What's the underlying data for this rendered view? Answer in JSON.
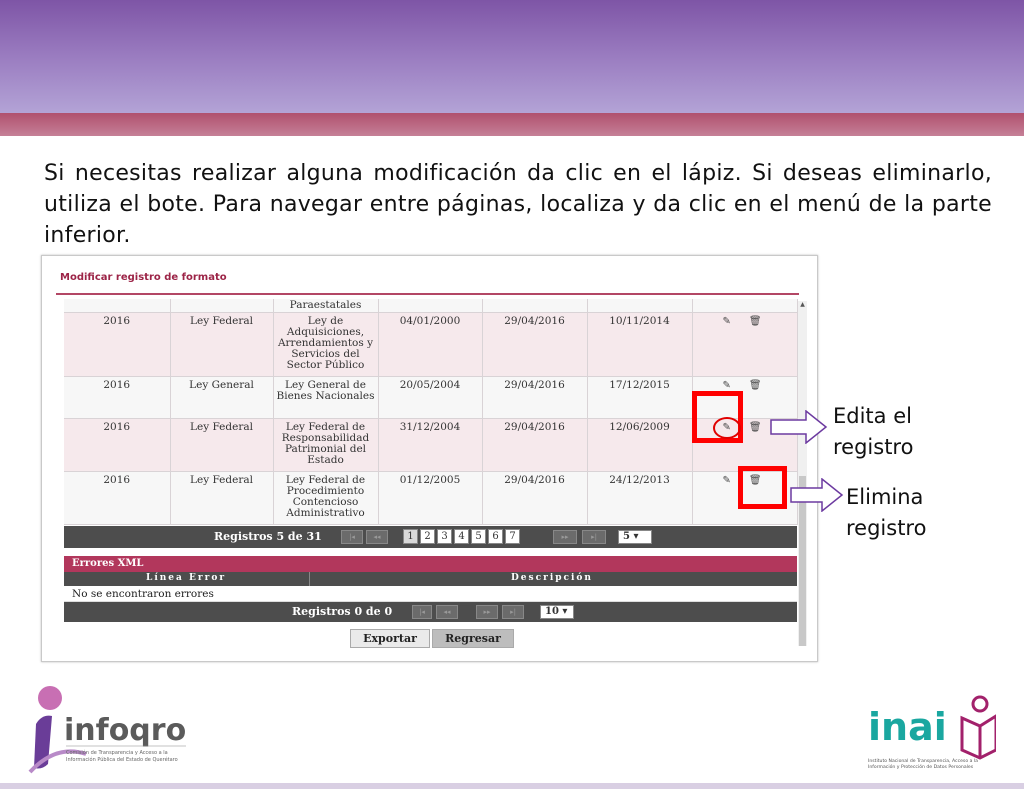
{
  "instruction": "Si necesitas realizar alguna modificación da clic en el lápiz. Si deseas eliminarlo, utiliza el bote. Para navegar entre páginas, localiza y da clic en el menú de la parte inferior.",
  "panel": {
    "title": "Modificar registro de formato",
    "header_cell": "Paraestatales",
    "rows": [
      {
        "year": "2016",
        "type": "Ley Federal",
        "name": "Ley de Adquisiciones, Arrendamientos y Servicios del Sector Público",
        "d1": "04/01/2000",
        "d2": "29/04/2016",
        "d3": "10/11/2014"
      },
      {
        "year": "2016",
        "type": "Ley General",
        "name": "Ley General de Bienes Nacionales",
        "d1": "20/05/2004",
        "d2": "29/04/2016",
        "d3": "17/12/2015"
      },
      {
        "year": "2016",
        "type": "Ley Federal",
        "name": "Ley Federal de Responsabilidad Patrimonial del Estado",
        "d1": "31/12/2004",
        "d2": "29/04/2016",
        "d3": "12/06/2009"
      },
      {
        "year": "2016",
        "type": "Ley Federal",
        "name": "Ley Federal de Procedimiento Contencioso Administrativo",
        "d1": "01/12/2005",
        "d2": "29/04/2016",
        "d3": "24/12/2013"
      }
    ],
    "pager": {
      "label": "Registros 5 de 31",
      "first": "|◂",
      "prev": "◂◂",
      "pages": [
        "1",
        "2",
        "3",
        "4",
        "5",
        "6",
        "7"
      ],
      "current_page": "1",
      "next": "▸▸",
      "last": "▸|",
      "page_size": "5 ▾"
    },
    "errors": {
      "title": "Errores XML",
      "col_line": "Línea Error",
      "col_desc": "Descripción",
      "message": "No se encontraron errores",
      "pager_label": "Registros 0 de 0",
      "first": "|◂",
      "prev": "◂◂",
      "next": "▸▸",
      "last": "▸|",
      "page_size": "10 ▾"
    },
    "export_label": "Exportar",
    "back_label": "Regresar"
  },
  "callouts": {
    "edit": "Edita el registro",
    "edit_line1": "Edita el",
    "edit_line2": "registro",
    "delete_line1": "Elimina",
    "delete_line2": "registro"
  },
  "logos": {
    "left_name": "infoqro",
    "left_caption_1": "Comisión de Transparencia y Acceso a la",
    "left_caption_2": "Información Pública del Estado de Querétaro",
    "right_name": "inai",
    "right_caption_1": "Instituto Nacional de Transparencia, Acceso a la",
    "right_caption_2": "Información y Protección de Datos Personales"
  },
  "icons": {
    "edit": "pencil-icon",
    "delete": "trash-icon"
  },
  "colors": {
    "header_purple": "#7e55a6",
    "strip_pink": "#b0506e",
    "highlight_red": "#ff0000",
    "arrow_purple": "#6c3aa0",
    "title_maroon": "#9c2447"
  }
}
